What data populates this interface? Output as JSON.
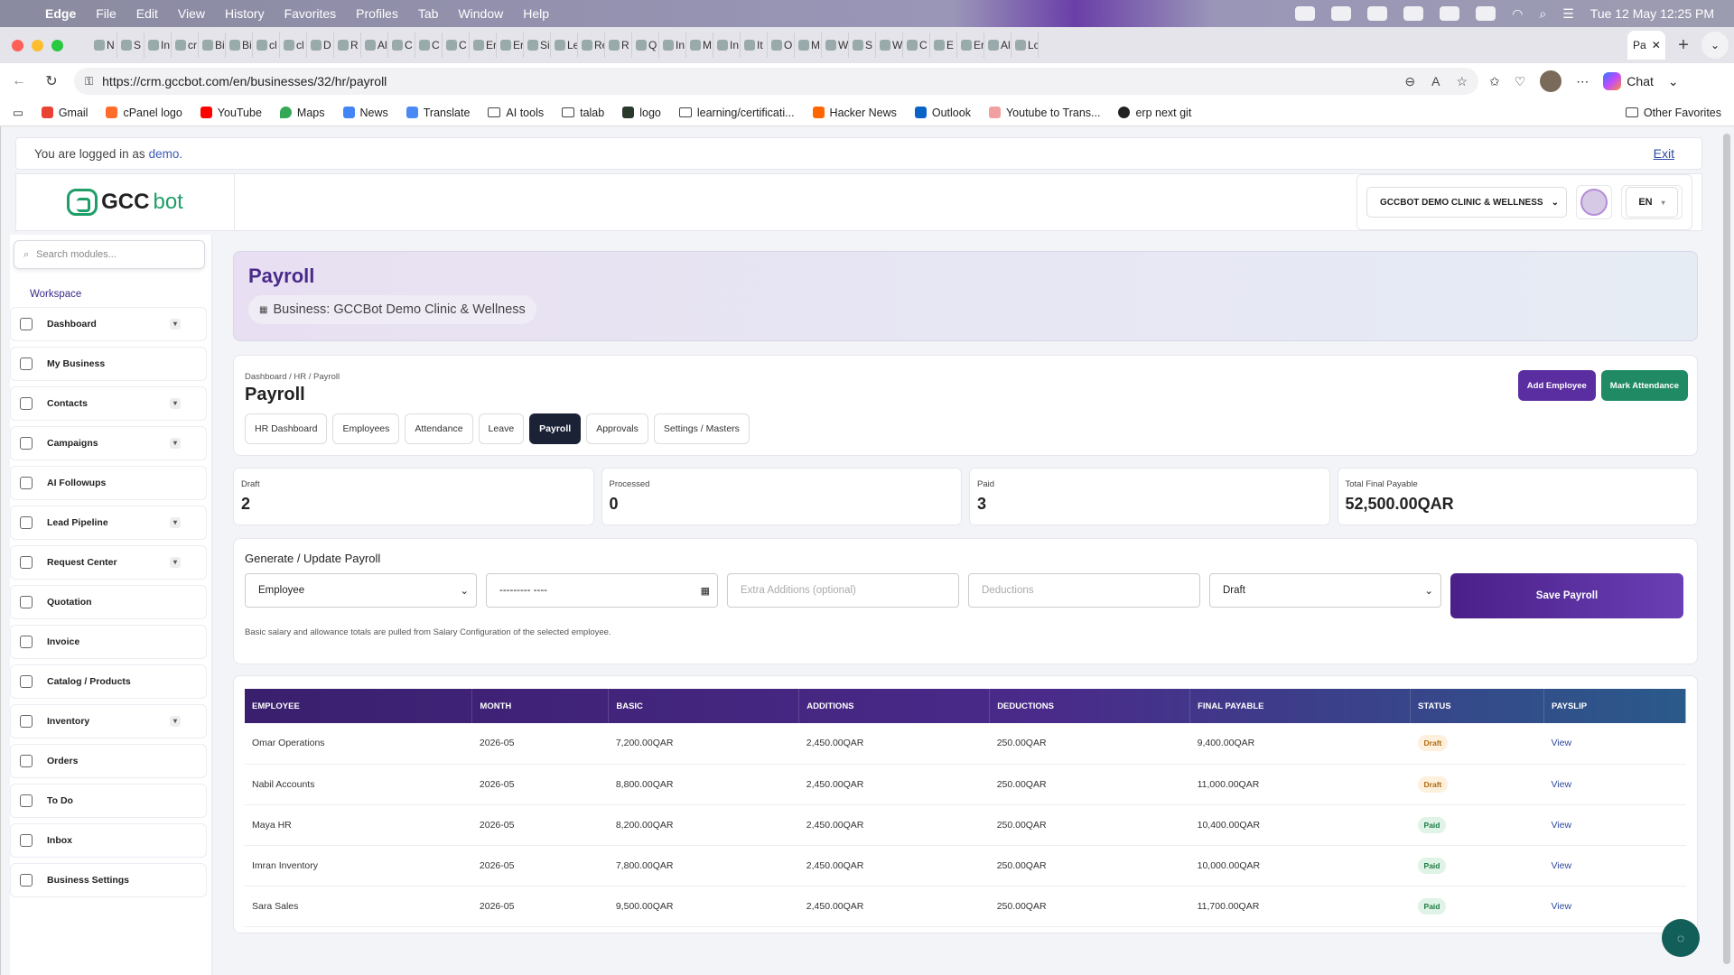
{
  "menubar": {
    "app": "Edge",
    "items": [
      "File",
      "Edit",
      "View",
      "History",
      "Favorites",
      "Profiles",
      "Tab",
      "Window",
      "Help"
    ],
    "datetime": "Tue 12 May  12:25 PM"
  },
  "browser": {
    "tab_letters": [
      "N",
      "S",
      "In",
      "cr",
      "Bi",
      "Bi",
      "cl",
      "cl",
      "D",
      "R",
      "Al",
      "C",
      "C",
      "C",
      "Er",
      "Er",
      "Si",
      "Le",
      "Re",
      "R",
      "Q",
      "In",
      "M",
      "In",
      "It",
      "O",
      "M",
      "W",
      "S",
      "W",
      "C",
      "E",
      "Er",
      "Al",
      "Lc"
    ],
    "active_tab": "Pa",
    "url": "https://crm.gccbot.com/en/businesses/32/hr/payroll",
    "chat_label": "Chat",
    "bookmarks": [
      "Gmail",
      "cPanel logo",
      "YouTube",
      "Maps",
      "News",
      "Translate",
      "AI tools",
      "talab",
      "logo",
      "learning/certificati...",
      "Hacker News",
      "Outlook",
      "Youtube to Trans...",
      "erp next git"
    ],
    "other_favorites": "Other Favorites"
  },
  "login": {
    "text": "You are logged in as",
    "user": "demo.",
    "exit": "Exit"
  },
  "header": {
    "logo_main": "GCC",
    "logo_bot": "bot",
    "business_select": "GCCBOT DEMO CLINIC & WELLNESS",
    "lang": "EN"
  },
  "sidebar": {
    "search_placeholder": "Search modules...",
    "workspace": "Workspace",
    "items": [
      {
        "label": "Dashboard",
        "chevron": true
      },
      {
        "label": "My Business",
        "chevron": false
      },
      {
        "label": "Contacts",
        "chevron": true
      },
      {
        "label": "Campaigns",
        "chevron": true
      },
      {
        "label": "AI Followups",
        "chevron": false
      },
      {
        "label": "Lead Pipeline",
        "chevron": true
      },
      {
        "label": "Request Center",
        "chevron": true
      },
      {
        "label": "Quotation",
        "chevron": false
      },
      {
        "label": "Invoice",
        "chevron": false
      },
      {
        "label": "Catalog / Products",
        "chevron": false
      },
      {
        "label": "Inventory",
        "chevron": true
      },
      {
        "label": "Orders",
        "chevron": false
      },
      {
        "label": "To Do",
        "chevron": false
      },
      {
        "label": "Inbox",
        "chevron": false
      },
      {
        "label": "Business Settings",
        "chevron": false
      }
    ]
  },
  "hero": {
    "title": "Payroll",
    "business": "Business: GCCBot Demo Clinic & Wellness"
  },
  "page": {
    "breadcrumb": "Dashboard / HR / Payroll",
    "title": "Payroll",
    "tabs": [
      "HR Dashboard",
      "Employees",
      "Attendance",
      "Leave",
      "Payroll",
      "Approvals",
      "Settings / Masters"
    ],
    "active_tab": "Payroll",
    "add_employee": "Add Employee",
    "mark_attendance": "Mark Attendance"
  },
  "stats": [
    {
      "label": "Draft",
      "value": "2"
    },
    {
      "label": "Processed",
      "value": "0"
    },
    {
      "label": "Paid",
      "value": "3"
    },
    {
      "label": "Total Final Payable",
      "value": "52,500.00QAR"
    }
  ],
  "form": {
    "title": "Generate / Update Payroll",
    "employee_select": "Employee",
    "month_placeholder": "--------- ----",
    "additions_placeholder": "Extra Additions (optional)",
    "deductions_placeholder": "Deductions",
    "status_select": "Draft",
    "save_button": "Save Payroll",
    "hint": "Basic salary and allowance totals are pulled from Salary Configuration of the selected employee."
  },
  "table": {
    "columns": [
      "EMPLOYEE",
      "MONTH",
      "BASIC",
      "ADDITIONS",
      "DEDUCTIONS",
      "FINAL PAYABLE",
      "STATUS",
      "PAYSLIP"
    ],
    "rows": [
      {
        "employee": "Omar Operations",
        "month": "2026-05",
        "basic": "7,200.00QAR",
        "additions": "2,450.00QAR",
        "deductions": "250.00QAR",
        "final": "9,400.00QAR",
        "status": "Draft",
        "payslip": "View"
      },
      {
        "employee": "Nabil Accounts",
        "month": "2026-05",
        "basic": "8,800.00QAR",
        "additions": "2,450.00QAR",
        "deductions": "250.00QAR",
        "final": "11,000.00QAR",
        "status": "Draft",
        "payslip": "View"
      },
      {
        "employee": "Maya HR",
        "month": "2026-05",
        "basic": "8,200.00QAR",
        "additions": "2,450.00QAR",
        "deductions": "250.00QAR",
        "final": "10,400.00QAR",
        "status": "Paid",
        "payslip": "View"
      },
      {
        "employee": "Imran Inventory",
        "month": "2026-05",
        "basic": "7,800.00QAR",
        "additions": "2,450.00QAR",
        "deductions": "250.00QAR",
        "final": "10,000.00QAR",
        "status": "Paid",
        "payslip": "View"
      },
      {
        "employee": "Sara Sales",
        "month": "2026-05",
        "basic": "9,500.00QAR",
        "additions": "2,450.00QAR",
        "deductions": "250.00QAR",
        "final": "11,700.00QAR",
        "status": "Paid",
        "payslip": "View"
      }
    ]
  },
  "colors": {
    "brand_purple": "#5a2da0",
    "brand_green": "#1f8a64",
    "logo_green": "#1f9e6a"
  }
}
